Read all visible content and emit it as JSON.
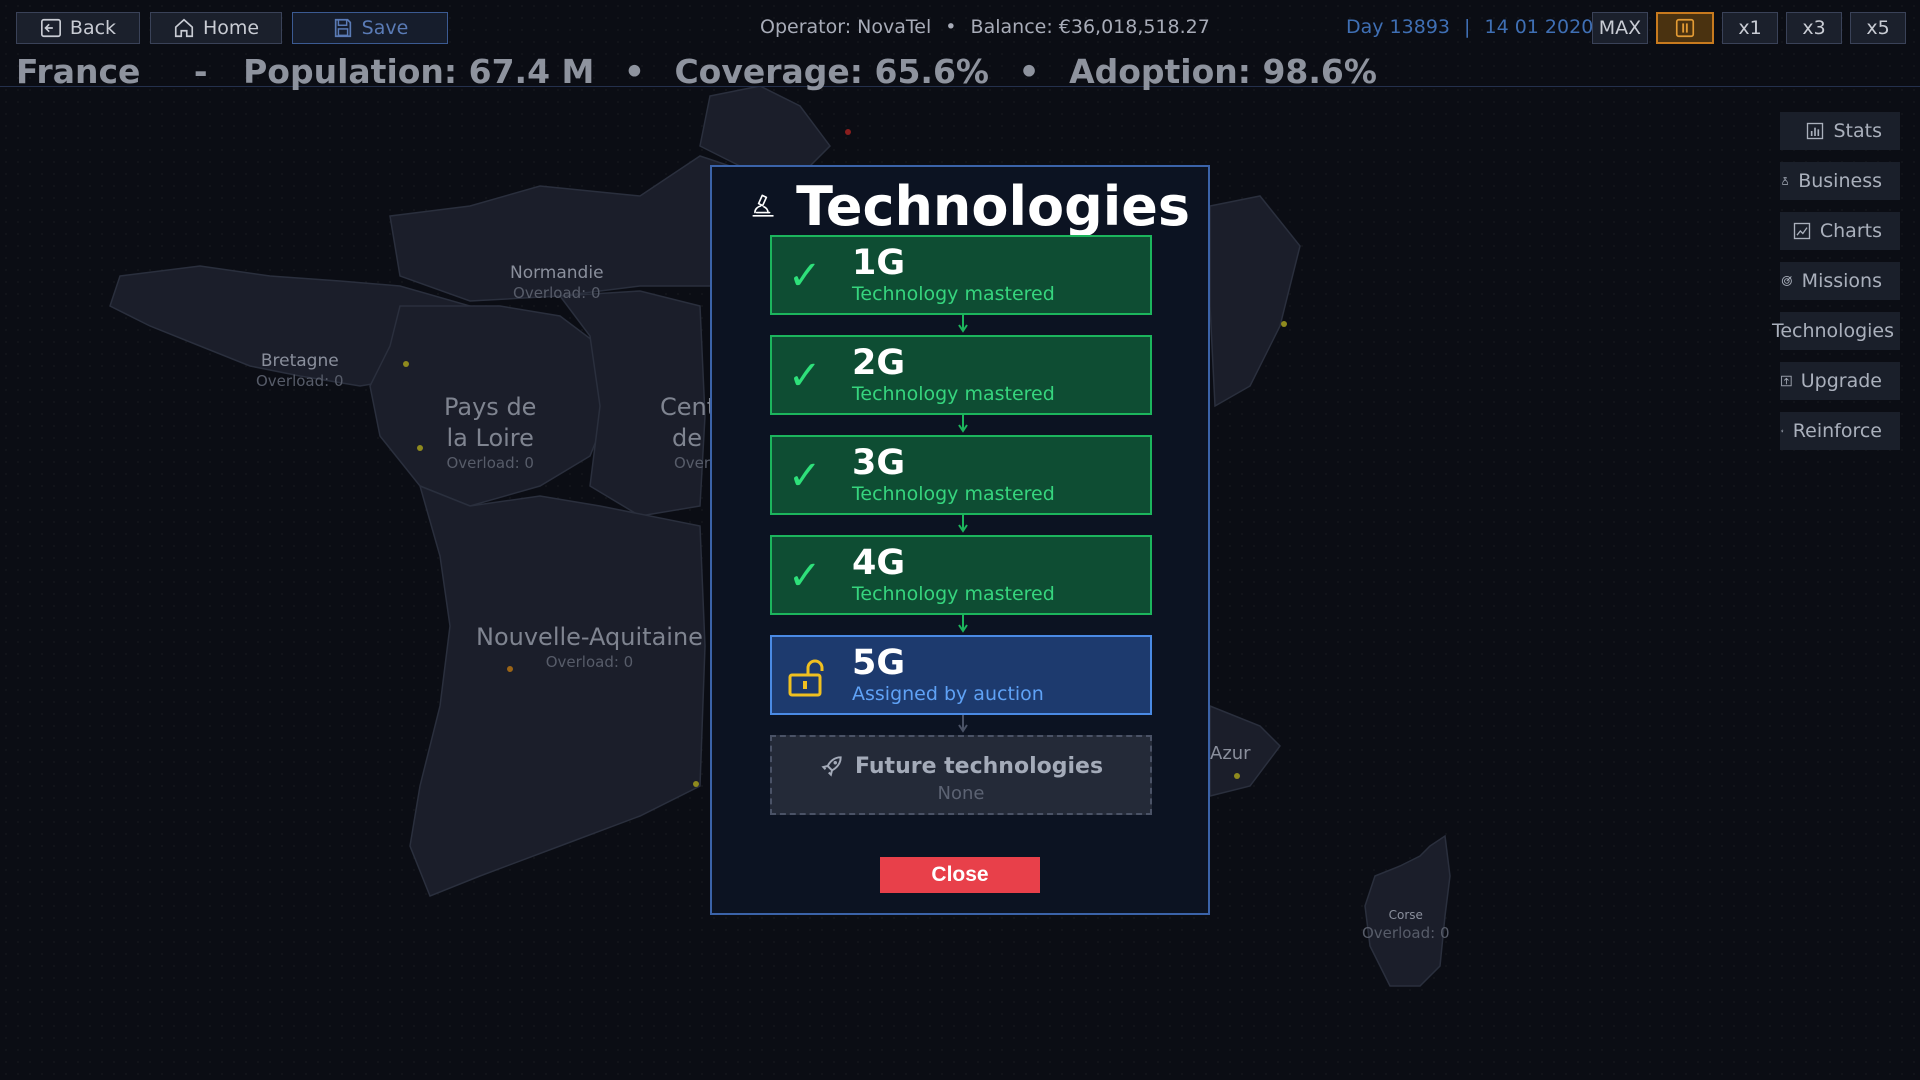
{
  "topbar": {
    "back_label": "Back",
    "home_label": "Home",
    "save_label": "Save",
    "operator_text": "Operator: NovaTel",
    "separator": "•",
    "balance_text": "Balance: €36,018,518.27",
    "day_text": "Day 13893",
    "day_sep": "|",
    "date_text": "14 01 2020",
    "speed": {
      "max_label": "MAX",
      "pause_icon": "pause-icon",
      "x1_label": "x1",
      "x3_label": "x3",
      "x5_label": "x5"
    }
  },
  "country_bar": {
    "country": "France",
    "dash": "-",
    "population": "Population: 67.4 M",
    "dot": "•",
    "coverage": "Coverage: 65.6%",
    "adoption": "Adoption: 98.6%"
  },
  "regions": [
    {
      "name": "Normandie",
      "overload": "Overload: 0"
    },
    {
      "name": "Bretagne",
      "overload": "Overload: 0"
    },
    {
      "name_line1": "Pays de",
      "name_line2": "la Loire",
      "overload": "Overload: 0"
    },
    {
      "name_line1": "Cent",
      "name_line2": "de",
      "overload": "Over"
    },
    {
      "name": "Nouvelle-Aquitaine",
      "overload": "Overload: 0"
    },
    {
      "name": "Azur"
    },
    {
      "name": "Corse",
      "overload": "Overload: 0"
    }
  ],
  "side_menu": [
    {
      "label": "Stats",
      "icon": "bar-chart-icon"
    },
    {
      "label": "Business",
      "icon": "money-bag-icon"
    },
    {
      "label": "Charts",
      "icon": "line-chart-icon"
    },
    {
      "label": "Missions",
      "icon": "target-icon"
    },
    {
      "label": "Technologies",
      "icon": "microscope-icon"
    },
    {
      "label": "Upgrade",
      "icon": "upgrade-icon"
    },
    {
      "label": "Reinforce",
      "icon": "lightning-icon"
    }
  ],
  "modal": {
    "title": "Technologies",
    "techs": [
      {
        "name": "1G",
        "status": "Technology mastered",
        "state": "mastered"
      },
      {
        "name": "2G",
        "status": "Technology mastered",
        "state": "mastered"
      },
      {
        "name": "3G",
        "status": "Technology mastered",
        "state": "mastered"
      },
      {
        "name": "4G",
        "status": "Technology mastered",
        "state": "mastered"
      },
      {
        "name": "5G",
        "status": "Assigned by auction",
        "state": "auction"
      }
    ],
    "check_glyph": "✓",
    "future_title": "Future technologies",
    "future_value": "None",
    "close_label": "Close"
  },
  "colors": {
    "mastered_bg": "#0e4d33",
    "mastered_border": "#1cb55d",
    "auction_bg": "#1d3a6e",
    "auction_border": "#4a8ae4",
    "close_bg": "#e8404a",
    "pause_accent": "#c87a1e"
  }
}
